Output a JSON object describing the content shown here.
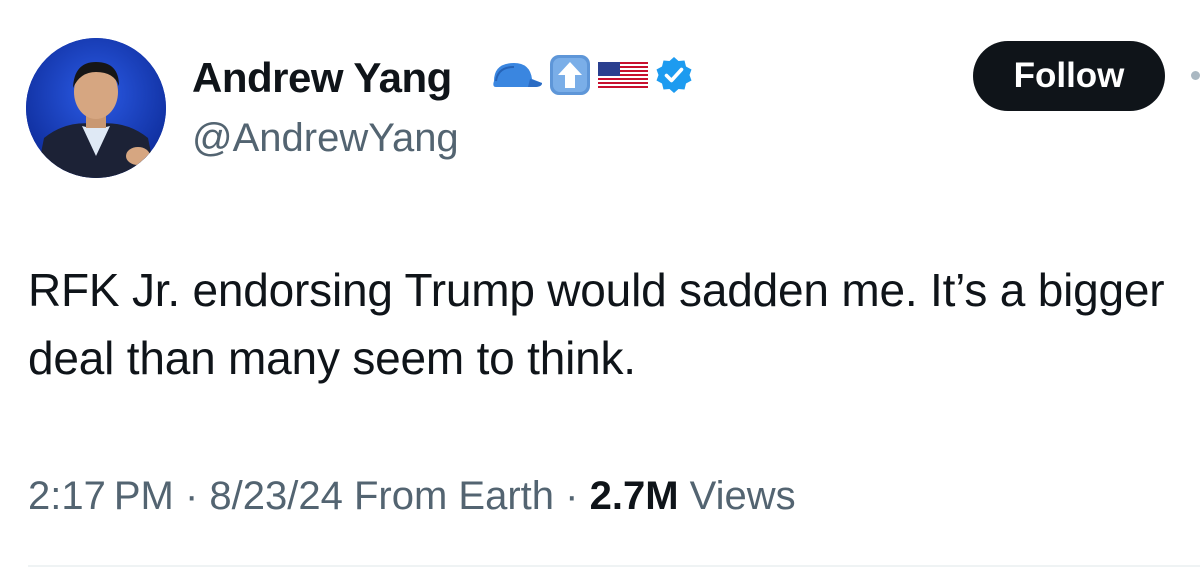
{
  "author": {
    "display_name": "Andrew Yang",
    "handle": "@AndrewYang",
    "verified": true,
    "name_emojis": [
      "blue-cap-icon",
      "up-arrow-icon",
      "us-flag-icon"
    ]
  },
  "follow_button": {
    "label": "Follow"
  },
  "tweet": {
    "text": "RFK Jr. endorsing Trump would sadden me.  It’s a bigger deal than many seem to think."
  },
  "meta": {
    "time": "2:17 PM",
    "separator": " · ",
    "date": "8/23/24",
    "source": "From Earth",
    "views_count": "2.7M",
    "views_label": "Views"
  },
  "colors": {
    "text_primary": "#0f1419",
    "text_secondary": "#536471",
    "verified_blue": "#1d9bf0",
    "follow_bg": "#0f1419"
  }
}
